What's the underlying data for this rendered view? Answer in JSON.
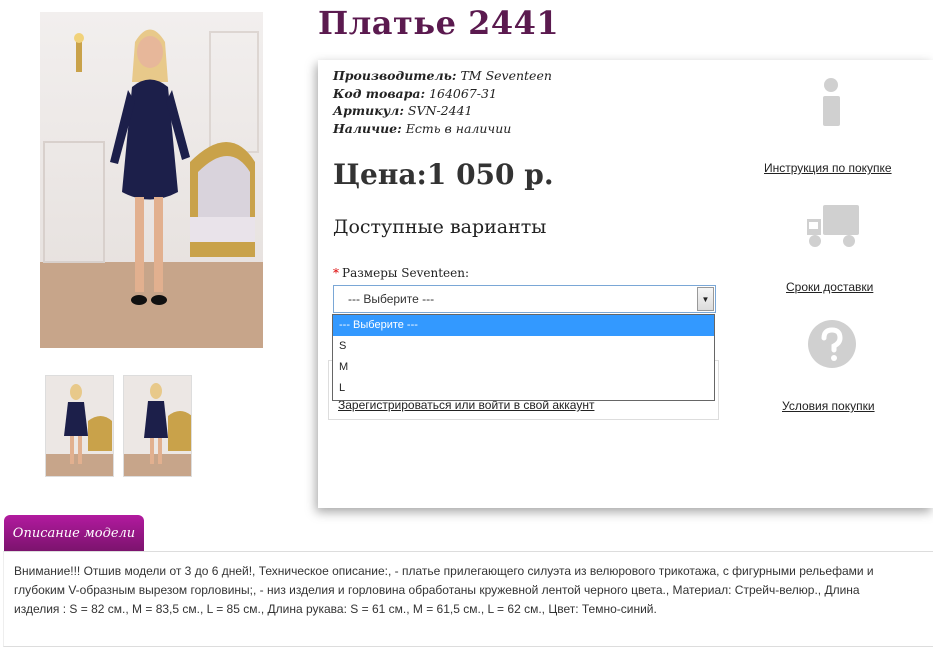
{
  "product": {
    "title": "Платье 2441",
    "manufacturer_label": "Производитель:",
    "manufacturer_value": "ТМ Seventeen",
    "code_label": "Код товара:",
    "code_value": "164067-31",
    "article_label": "Артикул:",
    "article_value": "SVN-2441",
    "stock_label": "Наличие:",
    "stock_value": "Есть в наличии",
    "price": "Цена:1 050 р."
  },
  "options": {
    "heading": "Доступные варианты",
    "required_mark": "*",
    "size_label": "Размеры Seventeen:",
    "selected": "--- Выберите ---",
    "dropdown": [
      "--- Выберите ---",
      "S",
      "M",
      "L"
    ]
  },
  "login_link": "Зарегистрироваться или войти в свой аккаунт",
  "sidebar": {
    "purchase_instructions": "Инструкция по покупке",
    "delivery_times": "Сроки доставки",
    "purchase_terms": "Условия покупки"
  },
  "tab_label": "Описание модели",
  "description": "Внимание!!! Отшив модели от 3 до 6 дней!, Техническое описание:, - платье прилегающего силуэта из велюрового трикотажа, с фигурными рельефами и глубоким V-образным вырезом горловины;, - низ изделия и горловина обработаны кружевной лентой черного цвета., Материал: Стрейч-велюр., Длина изделия : S = 82 см., M = 83,5 см., L = 85 см., Длина рукава: S = 61 см., M = 61,5 см., L = 62 см., Цвет: Темно-синий.",
  "colors": {
    "title": "#5b1a4f",
    "tab": "#9a1888",
    "dress": "#1c1f4a",
    "select_highlight": "#3399ff",
    "icon_grey": "#d0d0d0"
  }
}
